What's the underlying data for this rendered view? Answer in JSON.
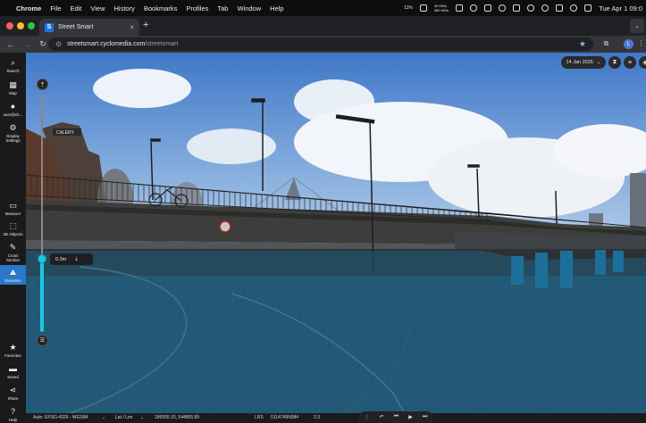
{
  "menubar": {
    "app": "Chrome",
    "items": [
      "File",
      "Edit",
      "View",
      "History",
      "Bookmarks",
      "Profiles",
      "Tab",
      "Window",
      "Help"
    ],
    "net_up": "40 KB/s",
    "net_down": "480 KB/s",
    "battery_pct": "11%",
    "datetime": "Tue Apr 1  09:0"
  },
  "browser": {
    "tab_title": "Street Smart",
    "favicon_letter": "S",
    "url_host": "streetsmart.cyclomedia.com",
    "url_path": "/streetsmart",
    "profile_letter": "L"
  },
  "sidebar": {
    "items": [
      {
        "label": "Search",
        "icon": "search-icon"
      },
      {
        "label": "Map",
        "icon": "map-icon"
      },
      {
        "label": "user@cb...",
        "icon": "user-icon"
      },
      {
        "label": "Display Settings",
        "icon": "gear-icon"
      },
      {
        "label": "Measure",
        "icon": "ruler-icon"
      },
      {
        "label": "3D Objects",
        "icon": "cube-icon"
      },
      {
        "label": "Cross Section",
        "icon": "pencil-icon"
      },
      {
        "label": "Elevation",
        "icon": "elevation-icon"
      },
      {
        "label": "Favorites",
        "icon": "star-icon"
      },
      {
        "label": "Saved",
        "icon": "folder-icon"
      },
      {
        "label": "Share",
        "icon": "share-icon"
      },
      {
        "label": "Help",
        "icon": "help-icon"
      }
    ],
    "active": "Elevation"
  },
  "viewer": {
    "date": "14 Jan 2025",
    "elevation_value": "0.3m",
    "building_sign": "CALERY"
  },
  "statusbar": {
    "projection": "Auto: EPSG:4326 - WGS84",
    "coord_mode": "Lat / Lon",
    "coordinates": "186555.15, 544805.89",
    "mode": "LRS",
    "image_id": "0114749N084",
    "zoom": "2.3"
  },
  "colors": {
    "accent": "#2a78c9",
    "elevation_overlay": "#1bc8e0"
  }
}
